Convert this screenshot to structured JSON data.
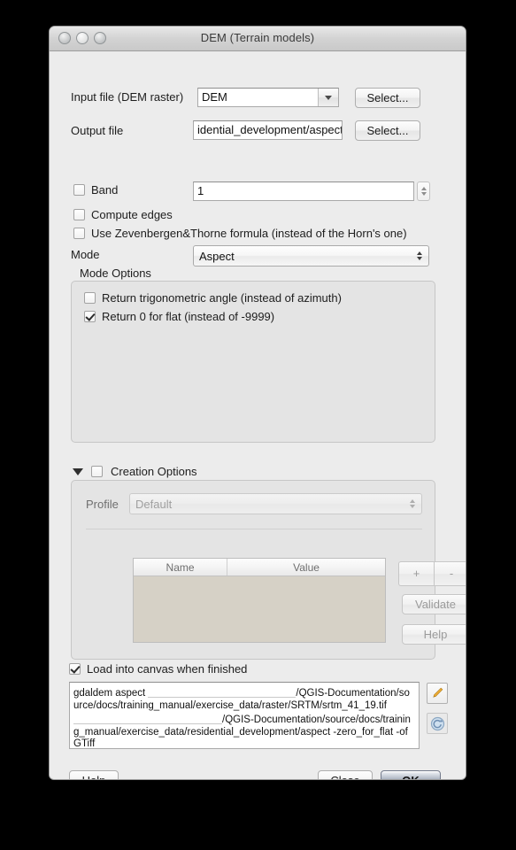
{
  "window": {
    "title": "DEM (Terrain models)",
    "traffic_lights": [
      "close-button",
      "minimize-button",
      "zoom-button"
    ]
  },
  "form": {
    "input_file_label": "Input file (DEM raster)",
    "input_file_value": "DEM",
    "input_select_label": "Select...",
    "output_file_label": "Output file",
    "output_file_value": "idential_development/aspect",
    "output_select_label": "Select...",
    "band_label": "Band",
    "band_checked": false,
    "band_value": "1",
    "compute_edges_label": "Compute edges",
    "compute_edges_checked": false,
    "zevenbergen_label": "Use Zevenbergen&Thorne formula (instead of the Horn's one)",
    "zevenbergen_checked": false,
    "mode_label": "Mode",
    "mode_value": "Aspect"
  },
  "mode_options": {
    "group_label": "Mode Options",
    "items": [
      {
        "label": "Return trigonometric angle (instead of azimuth)",
        "checked": false
      },
      {
        "label": "Return 0 for flat (instead of -9999)",
        "checked": true
      }
    ]
  },
  "creation_options": {
    "label": "Creation Options",
    "expanded": true,
    "checked": false,
    "profile_label": "Profile",
    "profile_value": "Default",
    "table": {
      "columns": [
        "Name",
        "Value"
      ],
      "rows": []
    },
    "add_label": "+",
    "remove_label": "-",
    "validate_label": "Validate",
    "help_label": "Help"
  },
  "footer": {
    "load_canvas_label": "Load into canvas when finished",
    "load_canvas_checked": true,
    "command_prefix": "gdaldem aspect ",
    "command_line1_suffix": "/QGIS-Documentation/source/docs/training_manual/exercise_data/raster/SRTM/srtm_41_19.tif ",
    "command_line2_suffix": "/QGIS-Documentation/source/docs/training_manual/exercise_data/residential_development/aspect -zero_for_flat -of GTiff",
    "edit_icon": "pencil-icon",
    "refresh_icon": "refresh-icon",
    "help_label": "Help",
    "close_label": "Close",
    "ok_label": "OK"
  }
}
